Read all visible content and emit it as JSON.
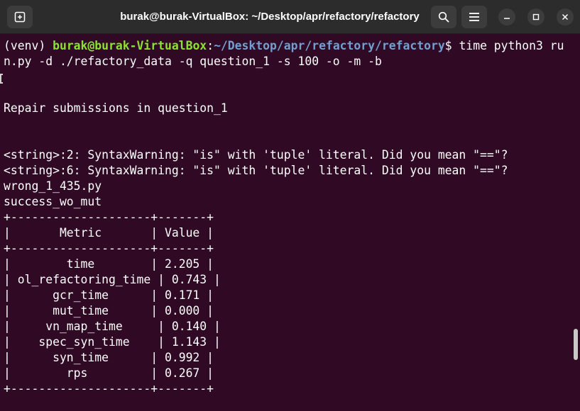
{
  "window": {
    "title": "burak@burak-VirtualBox: ~/Desktop/apr/refactory/refactory"
  },
  "icons": {
    "new_tab": "new-tab-icon",
    "search": "search-icon",
    "menu": "hamburger-menu-icon",
    "minimize": "minimize-icon",
    "maximize": "maximize-icon",
    "close": "close-icon"
  },
  "colors": {
    "terminal_bg": "#300a24",
    "titlebar_bg": "#2c2c2c",
    "prompt_user": "#8ae234",
    "prompt_path": "#729fcf",
    "text": "#ffffff"
  },
  "terminal": {
    "prompt": {
      "venv": "(venv) ",
      "user_host": "burak@burak-VirtualBox",
      "colon": ":",
      "path": "~/Desktop/apr/refactory/refactory",
      "dollar": "$ ",
      "command_part1": "time python3 ru",
      "command_part2": "n.py -d ./refactory_data -q question_1 -s 100 -o -m -b"
    },
    "output": [
      "",
      "",
      "Repair submissions in question_1",
      "",
      "",
      "<string>:2: SyntaxWarning: \"is\" with 'tuple' literal. Did you mean \"==\"?",
      "<string>:6: SyntaxWarning: \"is\" with 'tuple' literal. Did you mean \"==\"?",
      "wrong_1_435.py",
      "success_wo_mut",
      "+--------------------+-------+",
      "|       Metric       | Value |",
      "+--------------------+-------+",
      "|        time        | 2.205 |",
      "| ol_refactoring_time | 0.743 |",
      "|      gcr_time      | 0.171 |",
      "|      mut_time      | 0.000 |",
      "|     vn_map_time     | 0.140 |",
      "|    spec_syn_time    | 1.143 |",
      "|      syn_time      | 0.992 |",
      "|        rps         | 0.267 |",
      "+--------------------+-------+"
    ]
  }
}
